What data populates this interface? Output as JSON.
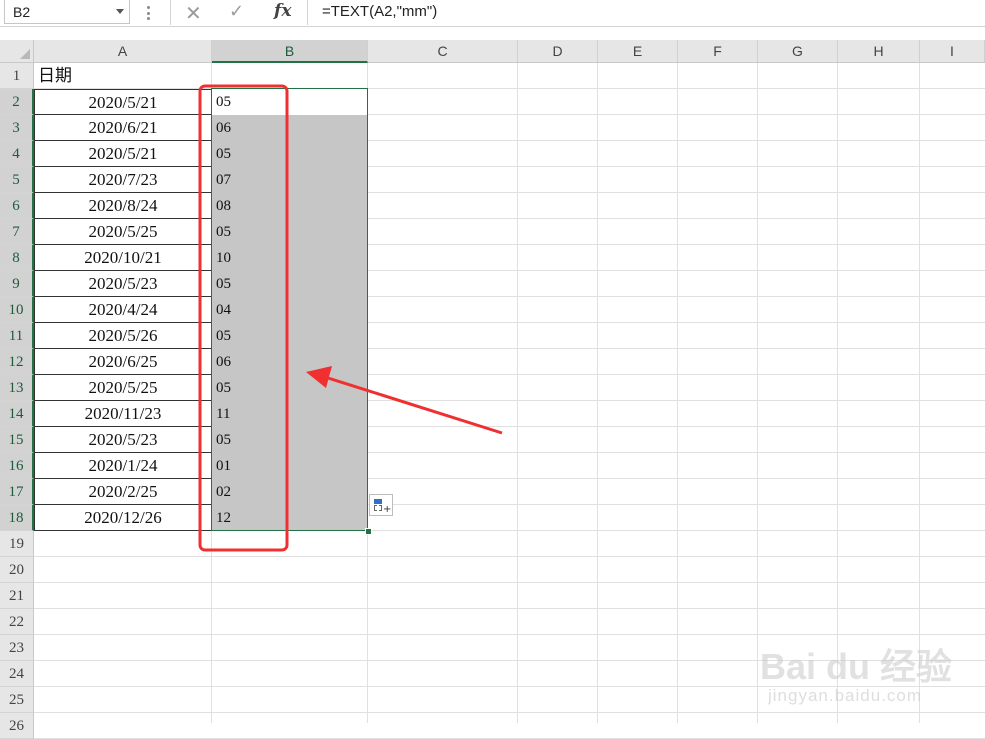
{
  "formula_bar": {
    "name_box": "B2",
    "formula": "=TEXT(A2,\"mm\")",
    "fx_label": "fx"
  },
  "columns": [
    "A",
    "B",
    "C",
    "D",
    "E",
    "F",
    "G",
    "H",
    "I"
  ],
  "rows": [
    "1",
    "2",
    "3",
    "4",
    "5",
    "6",
    "7",
    "8",
    "9",
    "10",
    "11",
    "12",
    "13",
    "14",
    "15",
    "16",
    "17",
    "18",
    "19",
    "20",
    "21",
    "22",
    "23",
    "24",
    "25",
    "26"
  ],
  "col_a_header": "日期",
  "dates": [
    "2020/5/21",
    "2020/6/21",
    "2020/5/21",
    "2020/7/23",
    "2020/8/24",
    "2020/5/25",
    "2020/10/21",
    "2020/5/23",
    "2020/4/24",
    "2020/5/26",
    "2020/6/25",
    "2020/5/25",
    "2020/11/23",
    "2020/5/23",
    "2020/1/24",
    "2020/2/25",
    "2020/12/26"
  ],
  "months": [
    "05",
    "06",
    "05",
    "07",
    "08",
    "05",
    "10",
    "05",
    "04",
    "05",
    "06",
    "05",
    "11",
    "05",
    "01",
    "02",
    "12"
  ],
  "colors": {
    "selection_border": "#217346",
    "annotation_red": "#f03030",
    "selection_fill": "#c6c6c6"
  },
  "icons": {
    "cancel": "close-icon",
    "enter": "check-icon",
    "insert_function": "fx-icon",
    "quick_analysis": "quick-analysis-icon"
  },
  "watermark": {
    "logo": "Bai du 经验",
    "url": "jingyan.baidu.com"
  }
}
